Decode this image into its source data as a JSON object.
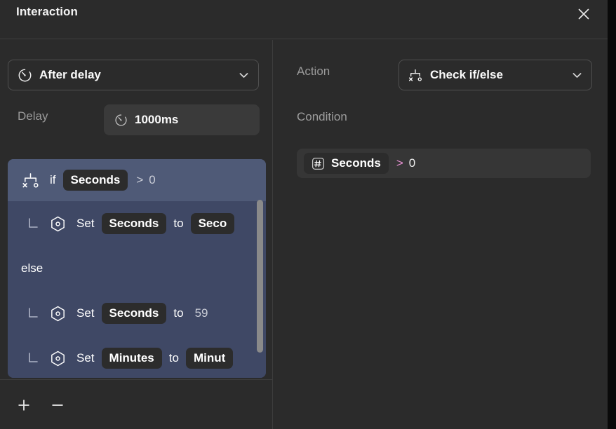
{
  "window": {
    "title": "Interaction",
    "close_icon": "close-icon"
  },
  "left": {
    "trigger": {
      "icon": "delay-clock-icon",
      "label": "After delay",
      "chevron_icon": "chevron-down-icon"
    },
    "delay": {
      "label": "Delay",
      "icon": "delay-clock-icon",
      "value": "1000ms"
    },
    "blocks": [
      {
        "kind": "header",
        "icon": "if-else-branch-icon",
        "keyword": "if",
        "variable": "Seconds",
        "operator": ">",
        "literal": "0"
      },
      {
        "kind": "child",
        "branch_glyph": "branch-elbow-icon",
        "icon": "set-hexagon-icon",
        "keyword": "Set",
        "variable": "Seconds",
        "connector": "to",
        "value_chip": "Seco"
      },
      {
        "kind": "else",
        "keyword": "else"
      },
      {
        "kind": "child",
        "branch_glyph": "branch-elbow-icon",
        "icon": "set-hexagon-icon",
        "keyword": "Set",
        "variable": "Seconds",
        "connector": "to",
        "literal": "59"
      },
      {
        "kind": "child",
        "branch_glyph": "branch-elbow-icon",
        "icon": "set-hexagon-icon",
        "keyword": "Set",
        "variable": "Minutes",
        "connector": "to",
        "value_chip": "Minut"
      }
    ],
    "toolbar": {
      "add_label": "+",
      "remove_label": "−"
    }
  },
  "right": {
    "action": {
      "label": "Action",
      "icon": "if-else-branch-icon",
      "value": "Check if/else",
      "chevron_icon": "chevron-down-icon"
    },
    "condition": {
      "label": "Condition",
      "variable_icon": "hash-variable-icon",
      "variable": "Seconds",
      "operator": ">",
      "value": "0"
    }
  },
  "colors": {
    "window_bg": "#2b2b2b",
    "block_header_bg": "#4f5a77",
    "block_child_bg": "#3f4865",
    "chip_bg": "#2c2c2c",
    "operator_pink": "#e58fd0",
    "muted_text": "#9a9a9a"
  }
}
